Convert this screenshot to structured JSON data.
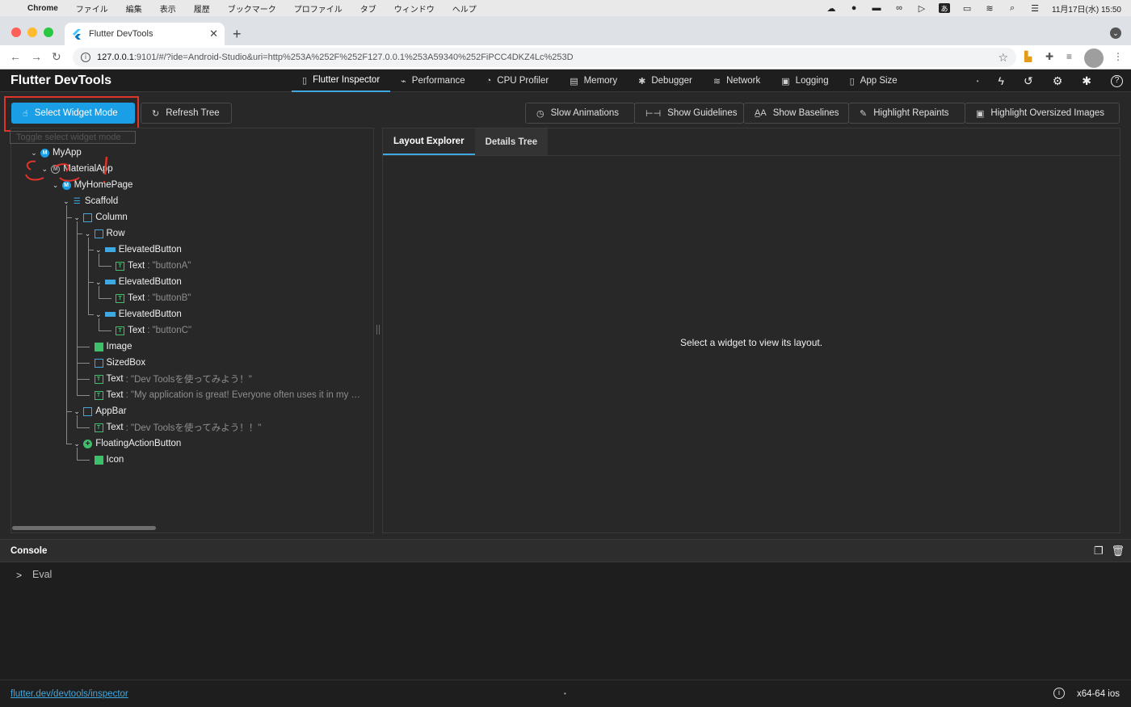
{
  "macos": {
    "menus": [
      "Chrome",
      "ファイル",
      "編集",
      "表示",
      "履歴",
      "ブックマーク",
      "プロファイル",
      "タブ",
      "ウィンドウ",
      "ヘルプ"
    ],
    "clock": "11月17日(水) 15:50"
  },
  "browser": {
    "tab_title": "Flutter DevTools",
    "url_host": "127.0.0.1",
    "url_rest": ":9101/#/?ide=Android-Studio&uri=http%253A%252F%252F127.0.0.1%253A59340%252FiPCC4DKZ4Lc%253D"
  },
  "devtools": {
    "title": "Flutter DevTools",
    "tabs": [
      {
        "label": "Flutter Inspector",
        "icon": "phone-icon",
        "active": true
      },
      {
        "label": "Performance",
        "icon": "pulse-icon",
        "active": false
      },
      {
        "label": "CPU Profiler",
        "icon": "gauge-icon",
        "active": false
      },
      {
        "label": "Memory",
        "icon": "memory-icon",
        "active": false
      },
      {
        "label": "Debugger",
        "icon": "bug-icon",
        "active": false
      },
      {
        "label": "Network",
        "icon": "wifi-icon",
        "active": false
      },
      {
        "label": "Logging",
        "icon": "logging-icon",
        "active": false
      },
      {
        "label": "App Size",
        "icon": "file-size-icon",
        "active": false
      }
    ]
  },
  "toolbar": {
    "select_widget_mode": "Select Widget Mode",
    "refresh_tree": "Refresh Tree",
    "slow_animations": "Slow Animations",
    "show_guidelines": "Show Guidelines",
    "show_baselines": "Show Baselines",
    "highlight_repaints": "Highlight Repaints",
    "highlight_oversized_images": "Highlight Oversized Images",
    "tooltip": "Toggle select widget mode"
  },
  "tree": [
    {
      "label": "MyApp",
      "icon": "circle-blue",
      "glyph": "M",
      "depth": 0,
      "expanded": true
    },
    {
      "label": "MaterialApp",
      "icon": "circle-gray",
      "glyph": "M",
      "depth": 1,
      "expanded": true
    },
    {
      "label": "MyHomePage",
      "icon": "circle-blue",
      "glyph": "M",
      "depth": 2,
      "expanded": true
    },
    {
      "label": "Scaffold",
      "icon": "blue-lines",
      "glyph": "☰",
      "depth": 3,
      "expanded": true
    },
    {
      "label": "Column",
      "icon": "blue-box",
      "glyph": "",
      "depth": 4,
      "expanded": true
    },
    {
      "label": "Row",
      "icon": "blue-box",
      "glyph": "",
      "depth": 5,
      "expanded": true
    },
    {
      "label": "ElevatedButton",
      "icon": "blue-btn",
      "glyph": "",
      "depth": 6,
      "expanded": true
    },
    {
      "label": "Text",
      "desc": ": \"buttonA\"",
      "icon": "text-green",
      "glyph": "T",
      "depth": 7
    },
    {
      "label": "ElevatedButton",
      "icon": "blue-btn",
      "glyph": "",
      "depth": 6,
      "expanded": true
    },
    {
      "label": "Text",
      "desc": ": \"buttonB\"",
      "icon": "text-green",
      "glyph": "T",
      "depth": 7
    },
    {
      "label": "ElevatedButton",
      "icon": "blue-btn",
      "glyph": "",
      "depth": 6,
      "expanded": true
    },
    {
      "label": "Text",
      "desc": ": \"buttonC\"",
      "icon": "text-green",
      "glyph": "T",
      "depth": 7
    },
    {
      "label": "Image",
      "icon": "green-img",
      "glyph": "",
      "depth": 5
    },
    {
      "label": "SizedBox",
      "icon": "blue-box",
      "glyph": "",
      "depth": 5
    },
    {
      "label": "Text",
      "desc": ": \"Dev Toolsを使ってみよう！\"",
      "icon": "text-green",
      "glyph": "T",
      "depth": 5
    },
    {
      "label": "Text",
      "desc": ": \"My application is great! Everyone often uses it in my …",
      "icon": "text-green",
      "glyph": "T",
      "depth": 5
    },
    {
      "label": "AppBar",
      "icon": "blue-box",
      "glyph": "",
      "depth": 4,
      "expanded": true
    },
    {
      "label": "Text",
      "desc": ": \"Dev Toolsを使ってみよう！！\"",
      "icon": "text-green",
      "glyph": "T",
      "depth": 5
    },
    {
      "label": "FloatingActionButton",
      "icon": "green-plus",
      "glyph": "+",
      "depth": 4,
      "expanded": true
    },
    {
      "label": "Icon",
      "icon": "green-img",
      "glyph": "",
      "depth": 5
    }
  ],
  "layout_panel": {
    "tabs": [
      "Layout Explorer",
      "Details Tree"
    ],
    "active_tab": "Layout Explorer",
    "message": "Select a widget to view its layout."
  },
  "console": {
    "title": "Console",
    "prompt": ">",
    "eval_label": "Eval"
  },
  "status": {
    "link": "flutter.dev/devtools/inspector",
    "platform": "x64-64 ios"
  },
  "colors": {
    "accent": "#1a9ee5",
    "annotation": "#e0332a"
  }
}
